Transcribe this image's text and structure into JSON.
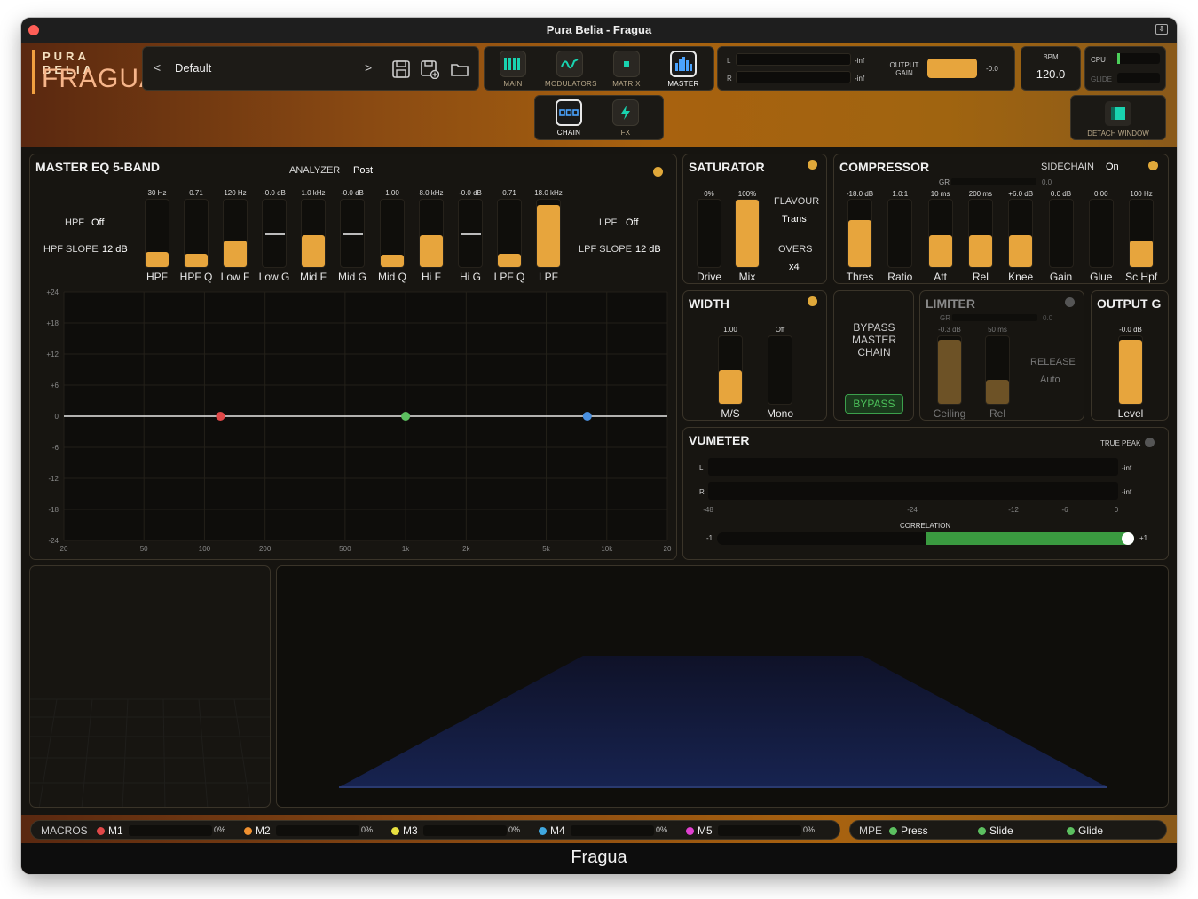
{
  "window": {
    "title": "Pura Belia - Fragua",
    "footer": "Fragua"
  },
  "logo": {
    "line1": "PURA BELIA",
    "line2": "FRAGUA"
  },
  "preset": {
    "prev": "<",
    "name": "Default",
    "next": ">"
  },
  "nav": [
    {
      "label": "MAIN",
      "icon": "bars-icon"
    },
    {
      "label": "MODULATORS",
      "icon": "wave-icon"
    },
    {
      "label": "MATRIX",
      "icon": "matrix-icon"
    },
    {
      "label": "MASTER",
      "icon": "eq-bars-icon",
      "active": true
    }
  ],
  "chain": [
    {
      "label": "CHAIN",
      "icon": "chain-icon",
      "active": true
    },
    {
      "label": "FX",
      "icon": "lightning-icon"
    }
  ],
  "meters": {
    "l": "L",
    "r": "R",
    "l_val": "-inf",
    "r_val": "-inf",
    "output_gain_label": "OUTPUT GAIN",
    "output_gain_value": "-0.0"
  },
  "bpm": {
    "label": "BPM",
    "value": "120.0"
  },
  "cpu": {
    "cpu_label": "CPU",
    "glide_label": "GLIDE"
  },
  "detach": {
    "label": "DETACH WINDOW"
  },
  "eq": {
    "title": "MASTER EQ 5-BAND",
    "analyzer_label": "ANALYZER",
    "analyzer_value": "Post",
    "hpf_label": "HPF",
    "hpf_value": "Off",
    "hpf_slope_label": "HPF SLOPE",
    "hpf_slope_value": "12 dB",
    "lpf_label": "LPF",
    "lpf_value": "Off",
    "lpf_slope_label": "LPF SLOPE",
    "lpf_slope_value": "12 dB",
    "sliders": [
      {
        "label": "HPF",
        "value": "30 Hz",
        "level": 0.22,
        "center": false
      },
      {
        "label": "HPF Q",
        "value": "0.71",
        "level": 0.2,
        "center": false
      },
      {
        "label": "Low F",
        "value": "120 Hz",
        "level": 0.4,
        "center": false
      },
      {
        "label": "Low G",
        "value": "-0.0 dB",
        "level": 0,
        "center": true
      },
      {
        "label": "Mid F",
        "value": "1.0 kHz",
        "level": 0.48,
        "center": false
      },
      {
        "label": "Mid G",
        "value": "-0.0 dB",
        "level": 0,
        "center": true
      },
      {
        "label": "Mid Q",
        "value": "1.00",
        "level": 0.18,
        "center": false
      },
      {
        "label": "Hi F",
        "value": "8.0 kHz",
        "level": 0.48,
        "center": false
      },
      {
        "label": "Hi G",
        "value": "-0.0 dB",
        "level": 0,
        "center": true
      },
      {
        "label": "LPF Q",
        "value": "0.71",
        "level": 0.2,
        "center": false
      },
      {
        "label": "LPF",
        "value": "18.0 kHz",
        "level": 0.92,
        "center": false
      }
    ],
    "graph": {
      "y_ticks": [
        "+24",
        "+18",
        "+12",
        "+6",
        "0",
        "-6",
        "-12",
        "-18",
        "-24"
      ],
      "x_ticks": [
        "20",
        "50",
        "100",
        "200",
        "500",
        "1k",
        "2k",
        "5k",
        "10k",
        "20"
      ],
      "nodes": [
        {
          "freq_hz": 120,
          "gain_db": 0,
          "color": "#e04848"
        },
        {
          "freq_hz": 1000,
          "gain_db": 0,
          "color": "#5cc060"
        },
        {
          "freq_hz": 8000,
          "gain_db": 0,
          "color": "#4a90e0"
        }
      ]
    }
  },
  "saturator": {
    "title": "SATURATOR",
    "drive_label": "Drive",
    "drive_value": "0%",
    "drive_level": 0,
    "mix_label": "Mix",
    "mix_value": "100%",
    "mix_level": 1,
    "flavour_label": "FLAVOUR",
    "flavour_value": "Trans",
    "overs_label": "OVERS",
    "overs_value": "x4"
  },
  "compressor": {
    "title": "COMPRESSOR",
    "sidechain_label": "SIDECHAIN",
    "sidechain_value": "On",
    "gr_label": "GR",
    "gr_value": "0.0",
    "sliders": [
      {
        "label": "Thres",
        "value": "-18.0 dB",
        "level": 0.7
      },
      {
        "label": "Ratio",
        "value": "1.0:1",
        "level": 0
      },
      {
        "label": "Att",
        "value": "10 ms",
        "level": 0.48
      },
      {
        "label": "Rel",
        "value": "200 ms",
        "level": 0.48
      },
      {
        "label": "Knee",
        "value": "+6.0 dB",
        "level": 0.48
      },
      {
        "label": "Gain",
        "value": "0.0 dB",
        "level": 0
      },
      {
        "label": "Glue",
        "value": "0.00",
        "level": 0
      },
      {
        "label": "Sc Hpf",
        "value": "100 Hz",
        "level": 0.4
      }
    ]
  },
  "width": {
    "title": "WIDTH",
    "ms_label": "M/S",
    "ms_value": "1.00",
    "ms_level": 0.5,
    "mono_label": "Mono",
    "mono_value": "Off",
    "mono_level": 0
  },
  "bypass": {
    "text": "BYPASS MASTER CHAIN",
    "button": "BYPASS"
  },
  "limiter": {
    "title": "LIMITER",
    "gr_label": "GR",
    "gr_value": "0.0",
    "ceiling_label": "Ceiling",
    "ceiling_value": "-0.3 dB",
    "ceiling_level": 0.95,
    "rel_label": "Rel",
    "rel_value": "50 ms",
    "rel_level": 0.35,
    "release_label": "RELEASE",
    "release_value": "Auto"
  },
  "output": {
    "title": "OUTPUT G",
    "level_label": "Level",
    "level_value": "-0.0 dB",
    "level": 0.95
  },
  "vumeter": {
    "title": "VUMETER",
    "true_peak_label": "TRUE PEAK",
    "l": "L",
    "r": "R",
    "l_val": "-inf",
    "r_val": "-inf",
    "scale": [
      "-48",
      "-24",
      "-12",
      "-6",
      "0"
    ],
    "correlation_label": "CORRELATION",
    "corr_min": "-1",
    "corr_max": "+1",
    "correlation": 1.0
  },
  "macros": {
    "label": "MACROS",
    "items": [
      {
        "name": "M1",
        "value": "0%",
        "color": "#e04848"
      },
      {
        "name": "M2",
        "value": "0%",
        "color": "#f09030"
      },
      {
        "name": "M3",
        "value": "0%",
        "color": "#e8e040"
      },
      {
        "name": "M4",
        "value": "0%",
        "color": "#40a8e0"
      },
      {
        "name": "M5",
        "value": "0%",
        "color": "#e040d0"
      }
    ]
  },
  "mpe": {
    "label": "MPE",
    "items": [
      {
        "name": "Press",
        "color": "#5cc060"
      },
      {
        "name": "Slide",
        "color": "#5cc060"
      },
      {
        "name": "Glide",
        "color": "#5cc060"
      }
    ]
  },
  "colors": {
    "accent": "#e7a53d",
    "bg": "#171511"
  }
}
